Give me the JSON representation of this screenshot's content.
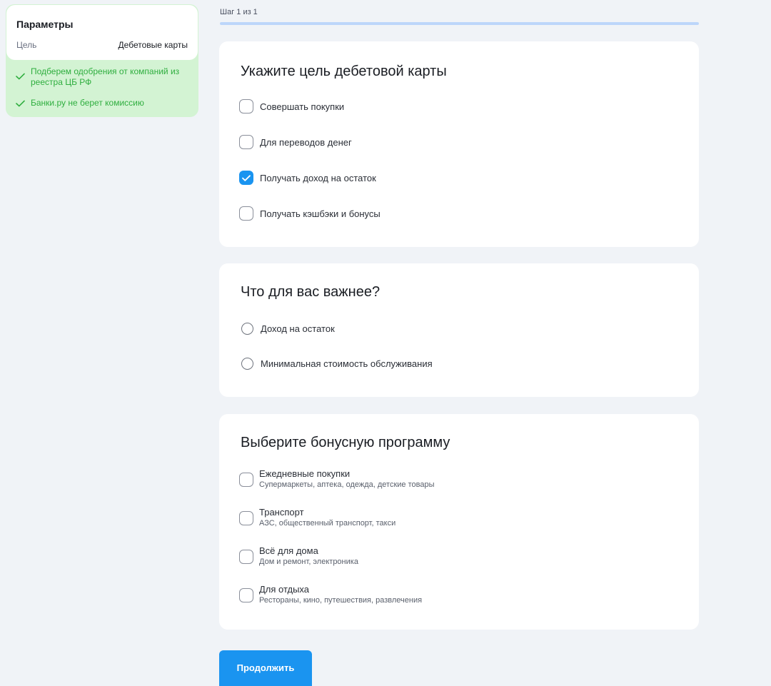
{
  "sidebar": {
    "title": "Параметры",
    "param_label": "Цель",
    "param_value": "Дебетовые карты",
    "benefits": [
      "Подберем одобрения от компаний из реестра ЦБ РФ",
      "Банки.ру не берет комиссию"
    ],
    "benefit_color": "#2fae3f"
  },
  "step": {
    "label": "Шаг 1 из 1",
    "progress": 1.0
  },
  "purpose": {
    "title": "Укажите цель дебетовой карты",
    "options": [
      {
        "label": "Совершать покупки",
        "checked": false
      },
      {
        "label": "Для переводов денег",
        "checked": false
      },
      {
        "label": "Получать доход на остаток",
        "checked": true
      },
      {
        "label": "Получать кэшбэки и бонусы",
        "checked": false
      }
    ]
  },
  "priority": {
    "title": "Что для вас важнее?",
    "options": [
      {
        "label": "Доход на остаток",
        "selected": false
      },
      {
        "label": "Минимальная стоимость обслуживания",
        "selected": false
      }
    ]
  },
  "bonus": {
    "title": "Выберите бонусную программу",
    "options": [
      {
        "label": "Ежедневные покупки",
        "description": "Супермаркеты, аптека, одежда, детские товары",
        "checked": false
      },
      {
        "label": "Транспорт",
        "description": "АЗС, общественный транспорт, такси",
        "checked": false
      },
      {
        "label": "Всё для дома",
        "description": "Дом и ремонт, электроника",
        "checked": false
      },
      {
        "label": "Для отдыха",
        "description": "Рестораны, кино, путешествия, развлечения",
        "checked": false
      }
    ]
  },
  "continue_label": "Продолжить",
  "accent_color": "#1a94f0"
}
